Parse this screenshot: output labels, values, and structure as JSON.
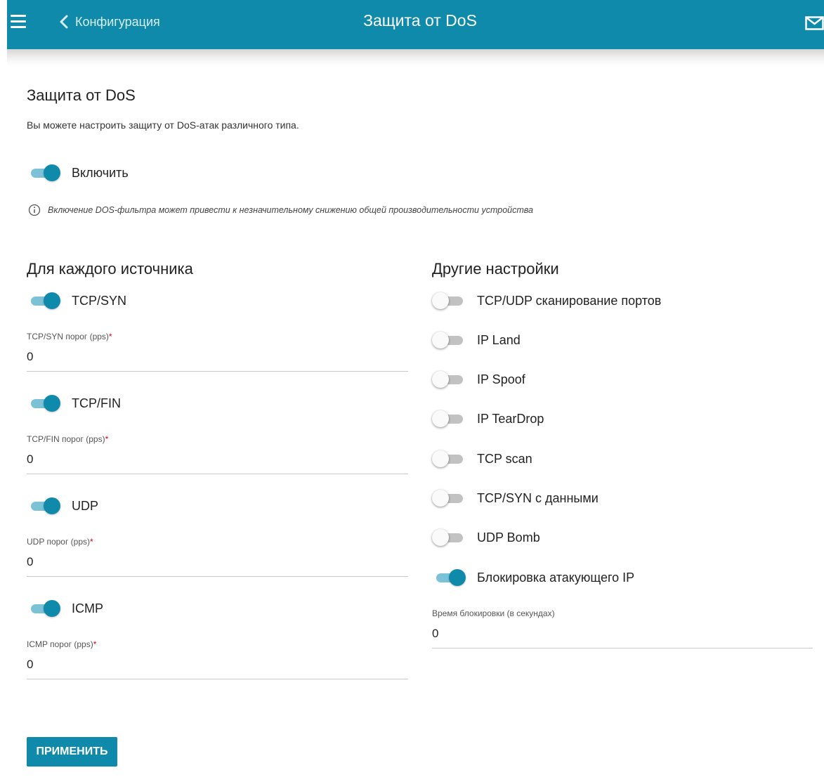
{
  "topbar": {
    "back_label": "Конфигурация",
    "title": "Защита от DoS",
    "color": "#0f8aab"
  },
  "page": {
    "title": "Защита от DoS",
    "description": "Вы можете настроить защиту от DoS-атак различного типа.",
    "enable_label": "Включить",
    "enable_on": true,
    "info_text": "Включение DOS-фильтра может привести к незначительному снижению общей производительности устройства"
  },
  "per_source": {
    "title": "Для каждого источника",
    "items": [
      {
        "label": "TCP/SYN",
        "on": true,
        "threshold_label": "TCP/SYN порог (pps)",
        "required_mark": "*",
        "value": "0"
      },
      {
        "label": "TCP/FIN",
        "on": true,
        "threshold_label": "TCP/FIN порог (pps)",
        "required_mark": "*",
        "value": "0"
      },
      {
        "label": "UDP",
        "on": true,
        "threshold_label": "UDP порог (pps)",
        "required_mark": "*",
        "value": "0"
      },
      {
        "label": "ICMP",
        "on": true,
        "threshold_label": "ICMP порог (pps)",
        "required_mark": "*",
        "value": "0"
      }
    ]
  },
  "other": {
    "title": "Другие настройки",
    "items": [
      {
        "label": "TCP/UDP сканирование портов",
        "on": false
      },
      {
        "label": "IP Land",
        "on": false
      },
      {
        "label": "IP Spoof",
        "on": false
      },
      {
        "label": "IP TearDrop",
        "on": false
      },
      {
        "label": "TCP scan",
        "on": false
      },
      {
        "label": "TCP/SYN с данными",
        "on": false
      },
      {
        "label": "UDP Bomb",
        "on": false
      },
      {
        "label": "Блокировка атакующего IP",
        "on": true
      }
    ],
    "block_time_label": "Время блокировки (в секундах)",
    "block_time_value": "0"
  },
  "actions": {
    "apply_label": "ПРИМЕНИТЬ"
  },
  "icons": {
    "menu": "hamburger-menu-icon",
    "back": "chevron-left-icon",
    "mail": "mail-icon",
    "info": "info-icon"
  }
}
